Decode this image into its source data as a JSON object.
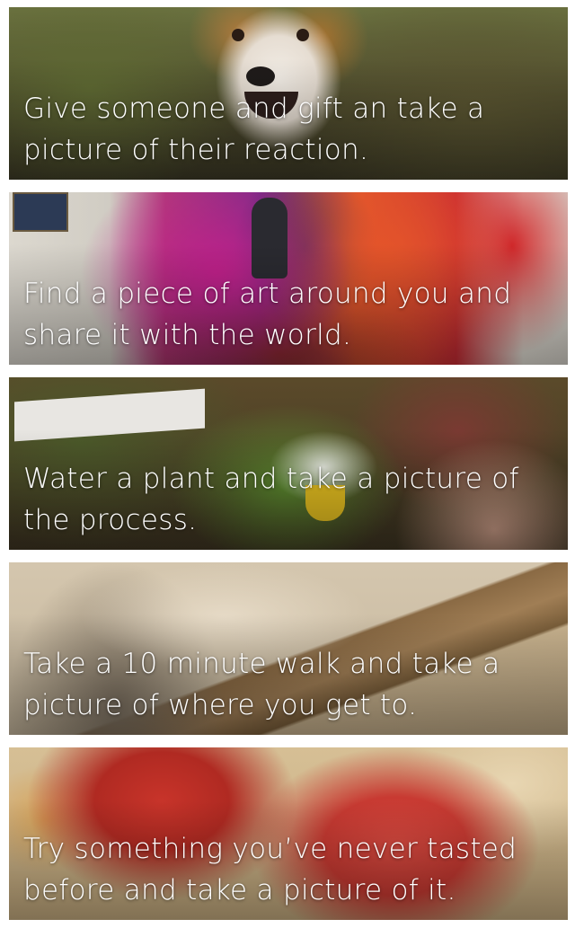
{
  "feed": {
    "cards": [
      {
        "image": "dog-photo",
        "caption": "Give someone and gift an take a picture of their reaction."
      },
      {
        "image": "art-installation-photo",
        "caption": "Find a piece of art around you and share it with the world."
      },
      {
        "image": "plant-photo",
        "caption": "Water a plant and take a picture of the process."
      },
      {
        "image": "sand-path-photo",
        "caption": "Take a 10 minute walk and take a picture of where you get to."
      },
      {
        "image": "fruit-photo",
        "caption": "Try something you’ve never tasted before and take a picture of it."
      }
    ]
  }
}
